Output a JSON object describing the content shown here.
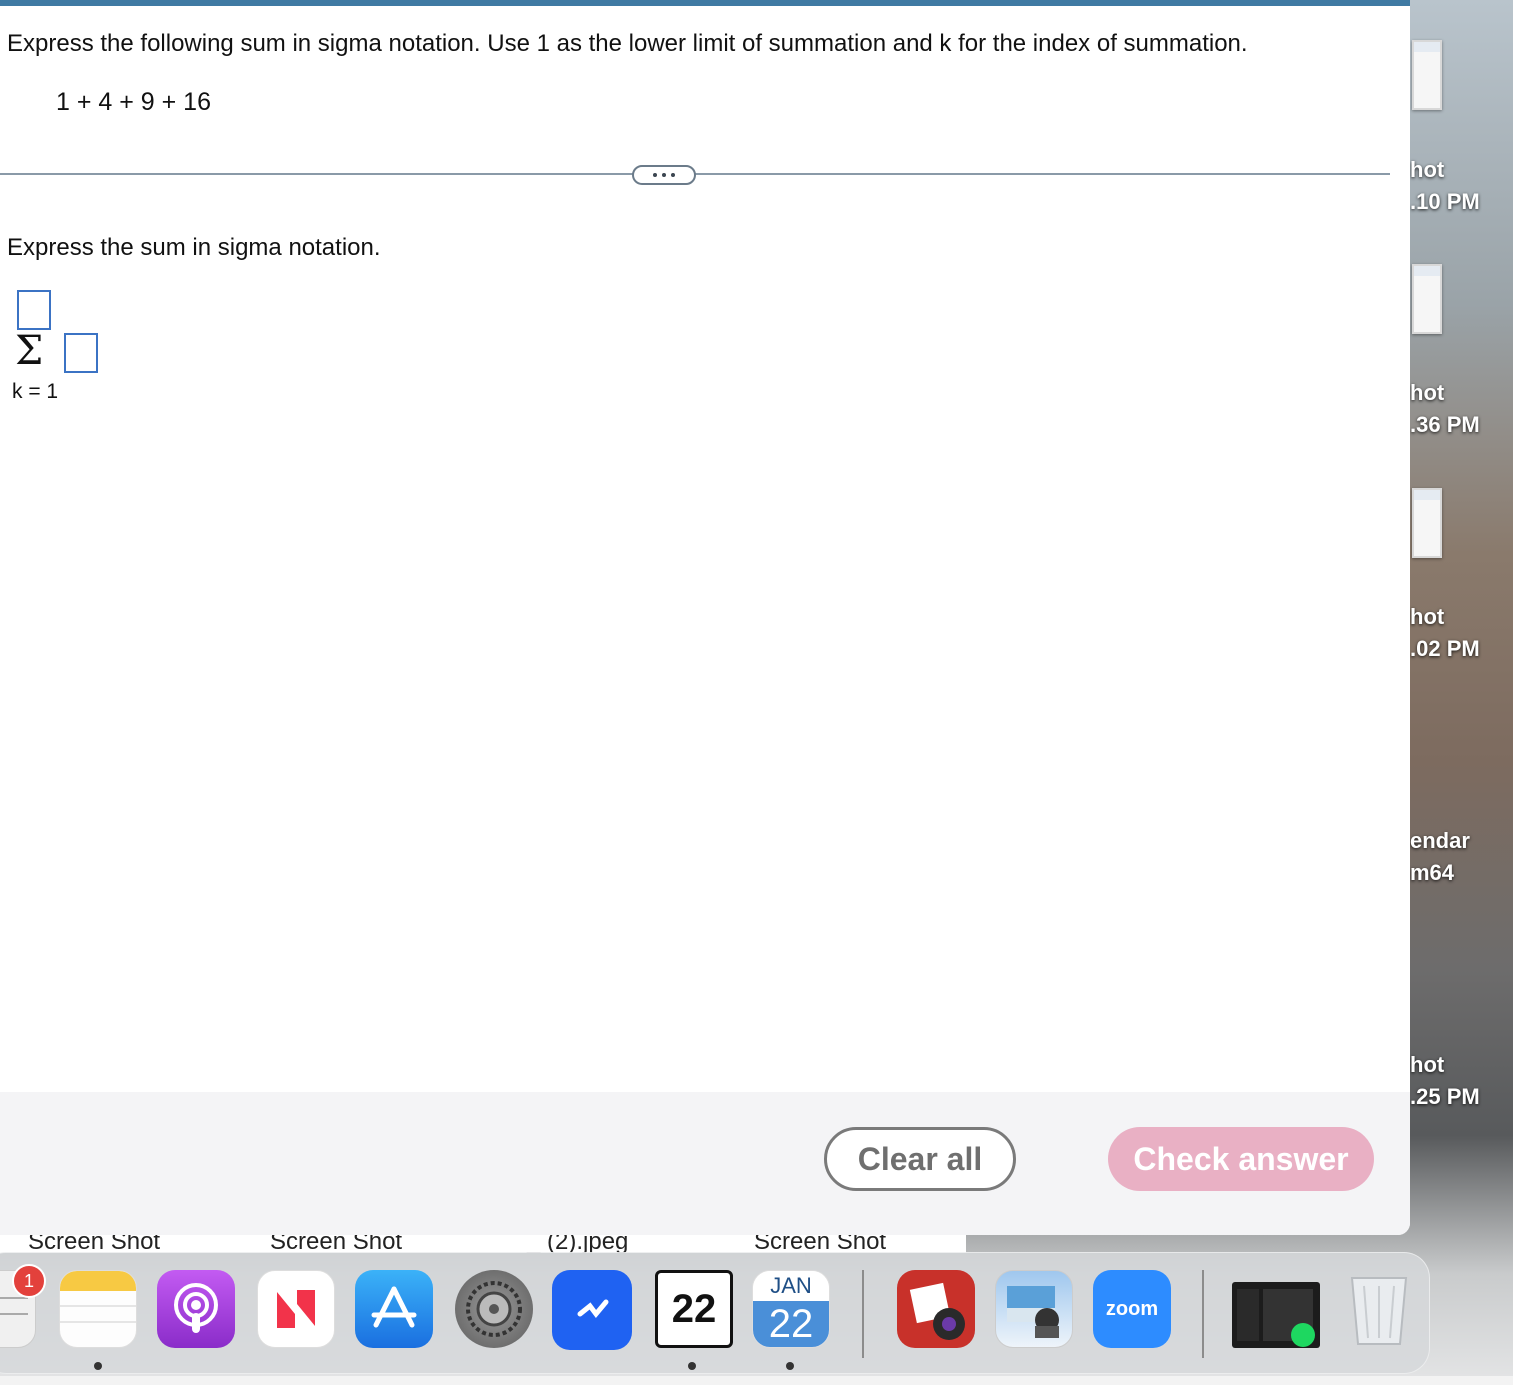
{
  "problem": {
    "question_text": "Express the following sum in sigma notation. Use 1 as the lower limit of summation and k for the index of summation.",
    "expression": "1 + 4 + 9 + 16",
    "instruction": "Express the sum in sigma notation.",
    "sigma_symbol": "Σ",
    "lower_limit": "k = 1",
    "upper_limit_value": "",
    "term_value": ""
  },
  "footer": {
    "clear_label": "Clear all",
    "check_label": "Check answer",
    "check_color": "#e9b0c4"
  },
  "files_strip": [
    "Screen Shot",
    "Screen Shot",
    "_ (2).jpeg",
    "Screen Shot"
  ],
  "desktop_files": [
    ".10 PM",
    ".36 PM",
    ".02 PM",
    ".25 PM"
  ],
  "desktop_labels": [
    "hot",
    "hot",
    "hot",
    "hot",
    "endar",
    "m64"
  ],
  "dock": {
    "badge_count": "1",
    "calendar_month": "JAN",
    "calendar_day": "22",
    "date_icon_day": "22",
    "zoom_label": "zoom",
    "apps": [
      "mail-icon",
      "notes-icon",
      "podcasts-icon",
      "news-icon",
      "app-store-icon",
      "system-preferences-icon",
      "bluetooth-file-icon",
      "calendar-date-icon",
      "calendar-icon",
      "photo-booth-icon",
      "preview-icon",
      "zoom-icon",
      "screenshot-icon",
      "trash-icon"
    ]
  }
}
